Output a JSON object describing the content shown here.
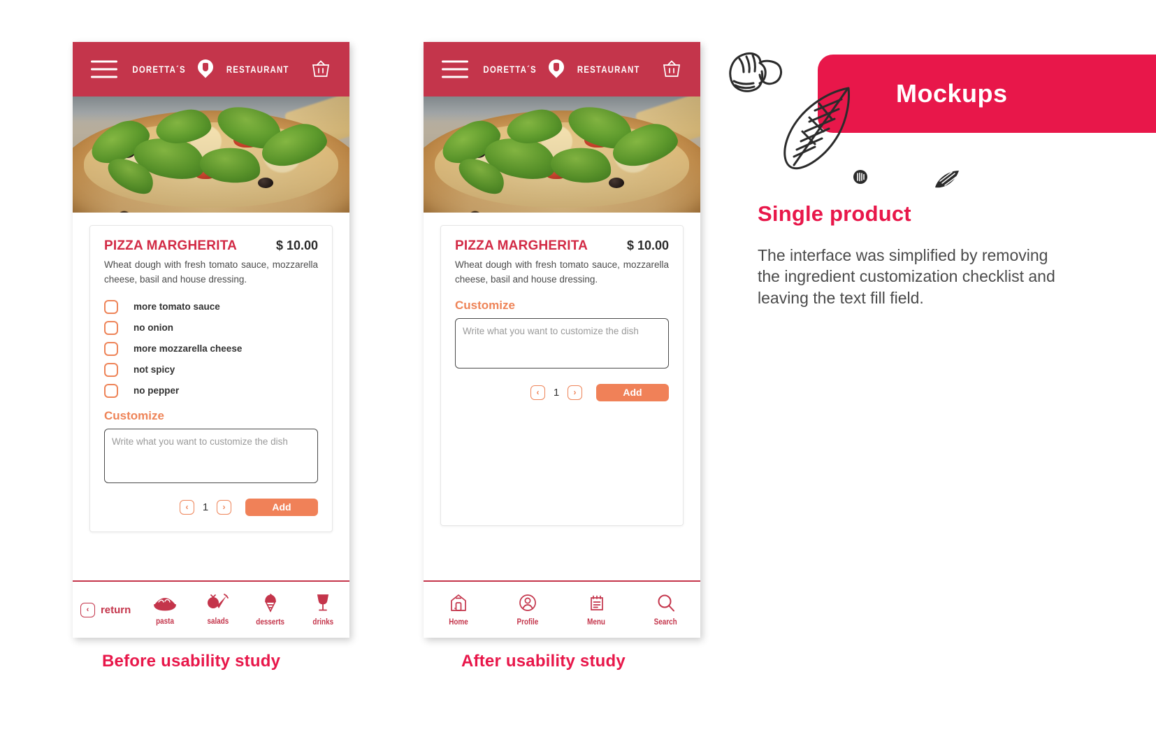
{
  "app": {
    "brand_left": "DORETTA´S",
    "brand_right": "RESTAURANT",
    "menu_icon": "hamburger-menu-icon",
    "cart_icon": "shopping-basket-icon"
  },
  "product": {
    "name": "PIZZA MARGHERITA",
    "price": "$ 10.00",
    "description": "Wheat dough with fresh tomato sauce, mozzarella cheese, basil and house dressing.",
    "hero_image_alt": "pizza-margherita-photo"
  },
  "options": [
    {
      "label": "more tomato sauce",
      "checked": false
    },
    {
      "label": "no onion",
      "checked": false
    },
    {
      "label": "more mozzarella cheese",
      "checked": false
    },
    {
      "label": "not spicy",
      "checked": false
    },
    {
      "label": "no pepper",
      "checked": false
    }
  ],
  "customize": {
    "title": "Customize",
    "placeholder_before": "Write what you want to customize the dish",
    "placeholder_after": "Write what you want to customize the dish",
    "value": ""
  },
  "quantity": {
    "decrement_label": "‹",
    "increment_label": "›",
    "value": "1",
    "add_label": "Add"
  },
  "nav_before": {
    "return_label": "return",
    "return_icon": "chevron-left-icon",
    "items": [
      {
        "label": "pasta",
        "icon": "pasta-bowl-icon"
      },
      {
        "label": "salads",
        "icon": "tomato-carrot-icon"
      },
      {
        "label": "desserts",
        "icon": "ice-cream-cone-icon"
      },
      {
        "label": "drinks",
        "icon": "wine-glass-icon"
      }
    ]
  },
  "nav_after": {
    "items": [
      {
        "label": "Home",
        "icon": "house-icon"
      },
      {
        "label": "Profile",
        "icon": "user-circle-icon"
      },
      {
        "label": "Menu",
        "icon": "notepad-menu-icon"
      },
      {
        "label": "Search",
        "icon": "magnifier-icon"
      }
    ]
  },
  "captions": {
    "before": "Before usability study",
    "after": "After usability study"
  },
  "panel": {
    "ribbon_title": "Mockups",
    "section_title": "Single product",
    "section_body": "The interface was simplified by removing the ingredient customization checklist and leaving the text fill field.",
    "decorations": [
      "mushroom-sketch-icon",
      "basil-leaf-sketch-icon",
      "seed-sketch-icon",
      "seed-sketch-icon"
    ]
  },
  "colors": {
    "brand_red": "#C4354B",
    "accent_pink": "#E8174A",
    "accent_orange": "#F08158",
    "checkbox_orange": "#EE8458"
  }
}
